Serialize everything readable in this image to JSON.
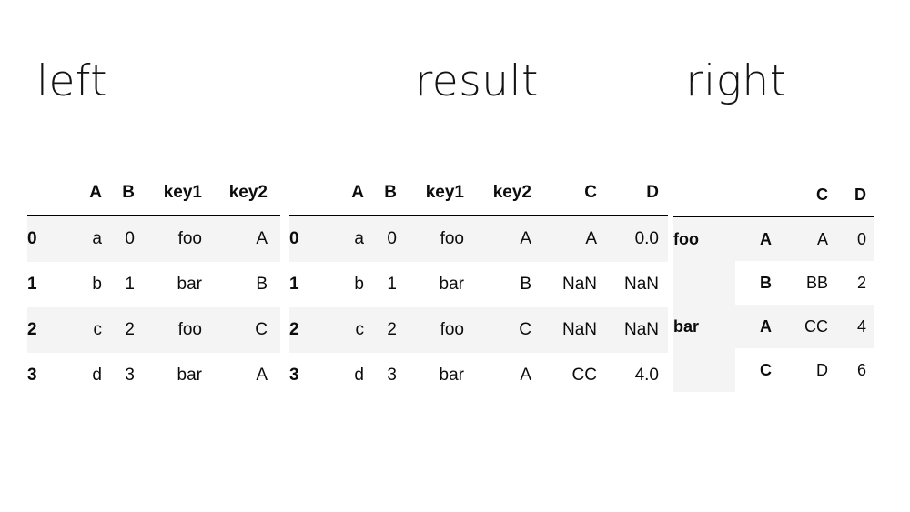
{
  "panels": {
    "left": {
      "title": "left"
    },
    "result": {
      "title": "result"
    },
    "right": {
      "title": "right"
    }
  },
  "tables": {
    "left": {
      "index_header": "",
      "columns": [
        "A",
        "B",
        "key1",
        "key2"
      ],
      "index": [
        "0",
        "1",
        "2",
        "3"
      ],
      "rows": [
        [
          "a",
          "0",
          "foo",
          "A"
        ],
        [
          "b",
          "1",
          "bar",
          "B"
        ],
        [
          "c",
          "2",
          "foo",
          "C"
        ],
        [
          "d",
          "3",
          "bar",
          "A"
        ]
      ]
    },
    "result": {
      "index_header": "",
      "columns": [
        "A",
        "B",
        "key1",
        "key2",
        "C",
        "D"
      ],
      "index": [
        "0",
        "1",
        "2",
        "3"
      ],
      "rows": [
        [
          "a",
          "0",
          "foo",
          "A",
          "A",
          "0.0"
        ],
        [
          "b",
          "1",
          "bar",
          "B",
          "NaN",
          "NaN"
        ],
        [
          "c",
          "2",
          "foo",
          "C",
          "NaN",
          "NaN"
        ],
        [
          "d",
          "3",
          "bar",
          "A",
          "CC",
          "4.0"
        ]
      ]
    },
    "right": {
      "index_headers": [
        "",
        ""
      ],
      "columns": [
        "C",
        "D"
      ],
      "index_level0": [
        "foo",
        "",
        "bar",
        ""
      ],
      "index_level1": [
        "A",
        "B",
        "A",
        "C"
      ],
      "rows": [
        [
          "A",
          "0"
        ],
        [
          "BB",
          "2"
        ],
        [
          "CC",
          "4"
        ],
        [
          "D",
          "6"
        ]
      ]
    }
  }
}
